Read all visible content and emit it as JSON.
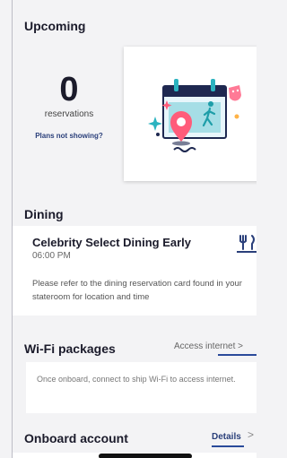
{
  "upcoming": {
    "title": "Upcoming",
    "count": "0",
    "count_label": "reservations",
    "plans_link": "Plans not showing?"
  },
  "dining": {
    "title": "Dining",
    "reservation_name": "Celebrity Select Dining Early",
    "reservation_time": "06:00 PM",
    "note": "Please refer to the dining reservation card found in your stateroom for location and time",
    "icon": "fork-knife-icon"
  },
  "wifi": {
    "title": "Wi-Fi packages",
    "link": "Access internet",
    "chevron": ">",
    "message": "Once onboard, connect to ship Wi-Fi to access internet."
  },
  "account": {
    "title": "Onboard account",
    "link": "Details",
    "chevron": ">"
  },
  "colors": {
    "link": "#2a3f7a",
    "accent_blue": "#2a4a9a",
    "illustration_teal": "#2bb3c0",
    "illustration_pink": "#ff5c7a"
  }
}
